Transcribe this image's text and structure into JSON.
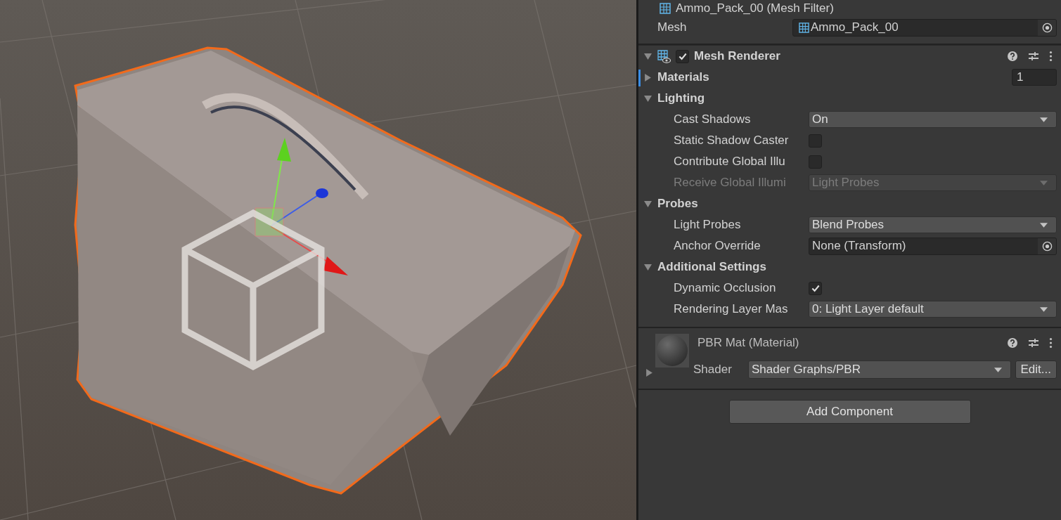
{
  "inspector": {
    "mesh_filter": {
      "title": "Ammo_Pack_00 (Mesh Filter)",
      "field": {
        "label": "Mesh",
        "value": "Ammo_Pack_00"
      }
    },
    "mesh_renderer": {
      "title": "Mesh Renderer",
      "enabled": true,
      "rows": [
        {
          "kind": "section",
          "label": "Materials",
          "expanded": false,
          "selected": true,
          "value": "1"
        },
        {
          "kind": "section",
          "label": "Lighting",
          "expanded": true,
          "selected": false
        },
        {
          "kind": "dropdown",
          "label": "Cast Shadows",
          "value": "On",
          "disabled": false
        },
        {
          "kind": "checkbox",
          "label": "Static Shadow Caster",
          "checked": false
        },
        {
          "kind": "checkbox",
          "label": "Contribute Global Illu",
          "checked": false
        },
        {
          "kind": "dropdown",
          "label": "Receive Global Illumi",
          "value": "Light Probes",
          "disabled": true
        },
        {
          "kind": "section",
          "label": "Probes",
          "expanded": true,
          "selected": false
        },
        {
          "kind": "dropdown",
          "label": "Light Probes",
          "value": "Blend Probes",
          "disabled": false
        },
        {
          "kind": "object",
          "label": "Anchor Override",
          "value": "None (Transform)"
        },
        {
          "kind": "section",
          "label": "Additional Settings",
          "expanded": true,
          "selected": false
        },
        {
          "kind": "checkbox",
          "label": "Dynamic Occlusion",
          "checked": true
        },
        {
          "kind": "dropdown",
          "label": "Rendering Layer Mas",
          "value": "0: Light Layer default",
          "disabled": false
        }
      ]
    },
    "material": {
      "title": "PBR Mat (Material)",
      "expanded": false,
      "shader_label": "Shader",
      "shader": "Shader Graphs/PBR",
      "edit_button": "Edit..."
    },
    "add_component": "Add Component"
  }
}
